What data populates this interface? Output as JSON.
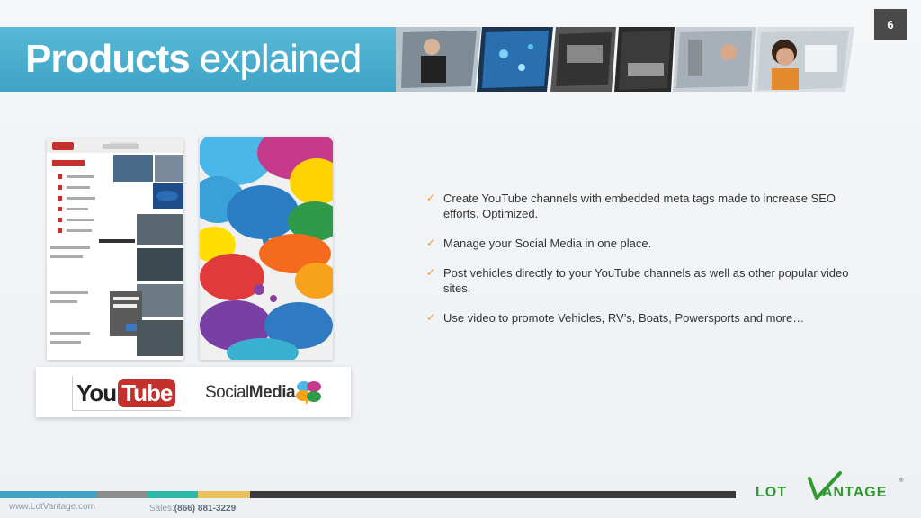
{
  "page_number": "6",
  "title": {
    "bold": "Products",
    "rest": " explained"
  },
  "images": {
    "youtube_screenshot": "YouTube channel screenshot",
    "social_screenshot": "Colorful speech bubbles artwork"
  },
  "logos": {
    "youtube": {
      "you": "You",
      "tube": "Tube"
    },
    "social_media": {
      "part1": "Social",
      "part2": "Media"
    }
  },
  "bullets": [
    "Create YouTube channels with embedded meta tags made to increase SEO efforts. Optimized.",
    "Manage your Social Media in one place.",
    "Post vehicles directly to your YouTube channels as well as other popular video sites.",
    "Use video to promote Vehicles, RV’s, Boats, Powersports and more…"
  ],
  "footer": {
    "website": "www.LotVantage.com",
    "sales_label": "Sales:",
    "sales_number": "(866) 881-3229",
    "bar_colors": [
      "#3ea3c6",
      "#8c8c8c",
      "#2bb8a6",
      "#e8c15a",
      "#3a3a3a"
    ]
  },
  "brand": {
    "name": "LOTVANTAGE",
    "color": "#2f9a2f"
  },
  "colors": {
    "title_bar": "#3ea3c6",
    "check": "#e0a23a",
    "page_number_bg": "#4a4a4a"
  }
}
